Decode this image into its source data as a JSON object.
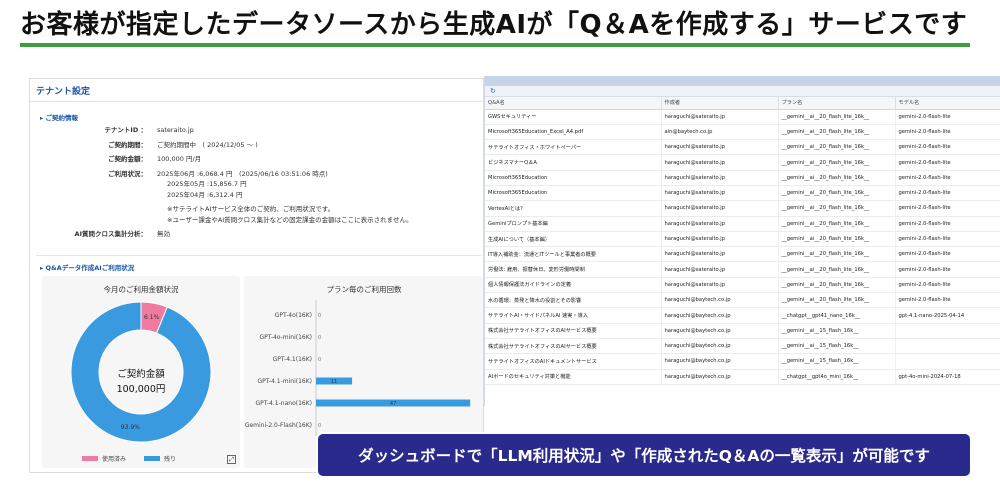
{
  "slide": {
    "title": "お客様が指定したデータソースから生成AIが「Q＆Aを作成する」サービスです",
    "accent_color": "#3e9e3e"
  },
  "dashboard": {
    "title": "テナント設定",
    "contract_section": "ご契約情報",
    "tenant_id_label": "テナントID ：",
    "tenant_id": "sateraito.jp",
    "period_label": "ご契約期間：",
    "period": "ご契約期間中　( 2024/12/05 ～ )",
    "amount_label": "ご契約金額：",
    "amount": "100,000 円/月",
    "usage_label": "ご利用状況：",
    "usage_lines": [
      "2025年06月 :6,068.4 円　(2025/06/16 03:51:06 時点)",
      "2025年05月 :15,856.7 円",
      "2025年04月 :6,312.4 円"
    ],
    "notes": [
      "※サテライトAIサービス全体のご契約、ご利用状況です。",
      "※ユーザー課金やAI質問クロス集計などの固定課金の金額はここに表示されません。"
    ],
    "cross_label": "AI質問クロス集計分析：",
    "cross_value": "無効",
    "qa_section": "Q&Aデータ作成AIご利用状況"
  },
  "chart_data": [
    {
      "type": "pie",
      "title": "今月のご利用金額状況",
      "center_label": "ご契約金額",
      "center_value": "100,000円",
      "slices": [
        {
          "name": "使用済み",
          "value": 6.1,
          "label": "6.1%",
          "color": "#f07aa0"
        },
        {
          "name": "残り",
          "value": 93.9,
          "label": "93.9%",
          "color": "#3a9ae0"
        }
      ]
    },
    {
      "type": "bar",
      "orientation": "horizontal",
      "title": "プラン毎のご利用回数",
      "categories": [
        "GPT-4o(16K)",
        "GPT-4o-mini(16K)",
        "GPT-4.1(16K)",
        "GPT-4.1-mini(16K)",
        "GPT-4.1-nano(16K)",
        "Gemini-2.0-Flash(16K)"
      ],
      "values": [
        0,
        0,
        0,
        11,
        47,
        0
      ],
      "data_labels": [
        "0",
        "0",
        "0",
        "11",
        "47",
        "0"
      ],
      "xlim": [
        0,
        50
      ],
      "color": "#3a9ae0"
    }
  ],
  "qa_table": {
    "refresh_icon": "refresh-icon",
    "headers": [
      "Q&A名",
      "作成者",
      "プラン名",
      "モデル名"
    ],
    "rows": [
      [
        "GWSセキュリティー",
        "haraguchi@sateraito.jp",
        "__gemini__ai__20_flash_lite_16k__",
        "gemini-2.0-flash-lite"
      ],
      [
        "Microsoft365Education_Excel_A4.pdf",
        "ain@baytech.co.jp",
        "__gemini__ai__20_flash_lite_16k__",
        "gemini-2.0-flash-lite"
      ],
      [
        "サテライトオフィス・ホワイトペーパー",
        "haraguchi@sateraito.jp",
        "__gemini__ai__20_flash_lite_16k__",
        "gemini-2.0-flash-lite"
      ],
      [
        "ビジネスマナーQ＆A",
        "haraguchi@sateraito.jp",
        "__gemini__ai__20_flash_lite_16k__",
        "gemini-2.0-flash-lite"
      ],
      [
        "Microsoft365Education",
        "haraguchi@sateraito.jp",
        "__gemini__ai__20_flash_lite_16k__",
        "gemini-2.0-flash-lite"
      ],
      [
        "Microsoft365Education",
        "haraguchi@sateraito.jp",
        "__gemini__ai__20_flash_lite_16k__",
        "gemini-2.0-flash-lite"
      ],
      [
        "VertexAIとは？",
        "haraguchi@sateraito.jp",
        "__gemini__ai__20_flash_lite_16k__",
        "gemini-2.0-flash-lite"
      ],
      [
        "Geminiプロンプト基本編",
        "haraguchi@sateraito.jp",
        "__gemini__ai__20_flash_lite_16k__",
        "gemini-2.0-flash-lite"
      ],
      [
        "生成AIについて（基本編）",
        "haraguchi@sateraito.jp",
        "__gemini__ai__20_flash_lite_16k__",
        "gemini-2.0-flash-lite"
      ],
      [
        "IT導入補助金：流通とITツールと事業者の概要",
        "haraguchi@sateraito.jp",
        "__gemini__ai__20_flash_lite_16k__",
        "gemini-2.0-flash-lite"
      ],
      [
        "労働法: 雇用、振替休日、変形労働時間制",
        "haraguchi@sateraito.jp",
        "__gemini__ai__20_flash_lite_16k__",
        "gemini-2.0-flash-lite"
      ],
      [
        "個人情報保護法ガイドラインの定義",
        "haraguchi@sateraito.jp",
        "__gemini__ai__20_flash_lite_16k__",
        "gemini-2.0-flash-lite"
      ],
      [
        "水の循環：蒸発と降水の役割とその影響",
        "haraguchi@baytech.co.jp",
        "__gemini__ai__20_flash_lite_16k__",
        "gemini-2.0-flash-lite"
      ],
      [
        "サテライトAI・サイドパネルAI 速実・導入",
        "haraguchi@baytech.co.jp",
        "__chatgpt__gpt41_nano_16k__",
        "gpt-4.1-nano-2025-04-14"
      ],
      [
        "株式会社サテライトオフィスのAIサービス概要",
        "haraguchi@baytech.co.jp",
        "__gemini__ai__15_flash_16k__",
        ""
      ],
      [
        "株式会社サテライトオフィスのAIサービス概要",
        "haraguchi@baytech.co.jp",
        "__gemini__ai__15_flash_16k__",
        ""
      ],
      [
        "サテライトオフィスのAIドキュメントサービス",
        "haraguchi@baytech.co.jp",
        "__gemini__ai__15_flash_16k__",
        ""
      ],
      [
        "AIボードのセキュリティ対策と機能",
        "haraguchi@baytech.co.jp",
        "__chatgpt__gpt4o_mini_16k__",
        "gpt-4o-mini-2024-07-18"
      ]
    ]
  },
  "callout": {
    "text": "ダッシュボードで「LLM利用状況」や「作成されたQ＆Aの一覧表示」が可能です"
  }
}
